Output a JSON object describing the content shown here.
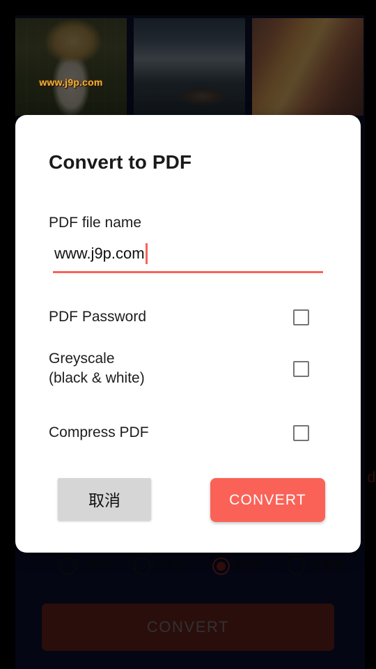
{
  "background": {
    "thumbnails": [
      {
        "name": "portrait-woman-with-straw-hat",
        "watermark": "www.j9p.com"
      },
      {
        "name": "mountain-lake-landscape",
        "watermark": ""
      },
      {
        "name": "slot-canyon-rock-formation",
        "watermark": ""
      }
    ],
    "format_options": [
      {
        "label": "JPG",
        "selected": false
      },
      {
        "label": "PNG",
        "selected": false
      },
      {
        "label": "PDF",
        "selected": true
      },
      {
        "label": "WEB",
        "selected": false
      }
    ],
    "convert_button_label": "CONVERT",
    "clipped_text": "d"
  },
  "dialog": {
    "title": "Convert to PDF",
    "filename_label": "PDF file name",
    "filename_value": "www.j9p.com",
    "options": [
      {
        "label": "PDF Password",
        "checked": false
      },
      {
        "label": "Greyscale\n(black & white)",
        "line1": "Greyscale",
        "line2": "(black & white)",
        "checked": false
      },
      {
        "label": "Compress PDF",
        "checked": false
      }
    ],
    "cancel_label": "取消",
    "convert_label": "CONVERT"
  },
  "colors": {
    "accent_coral": "#fa6258",
    "accent_dim_red": "#6a231e",
    "app_background": "#0c1030",
    "checkbox_border": "#757575",
    "dialog_background": "#ffffff"
  }
}
